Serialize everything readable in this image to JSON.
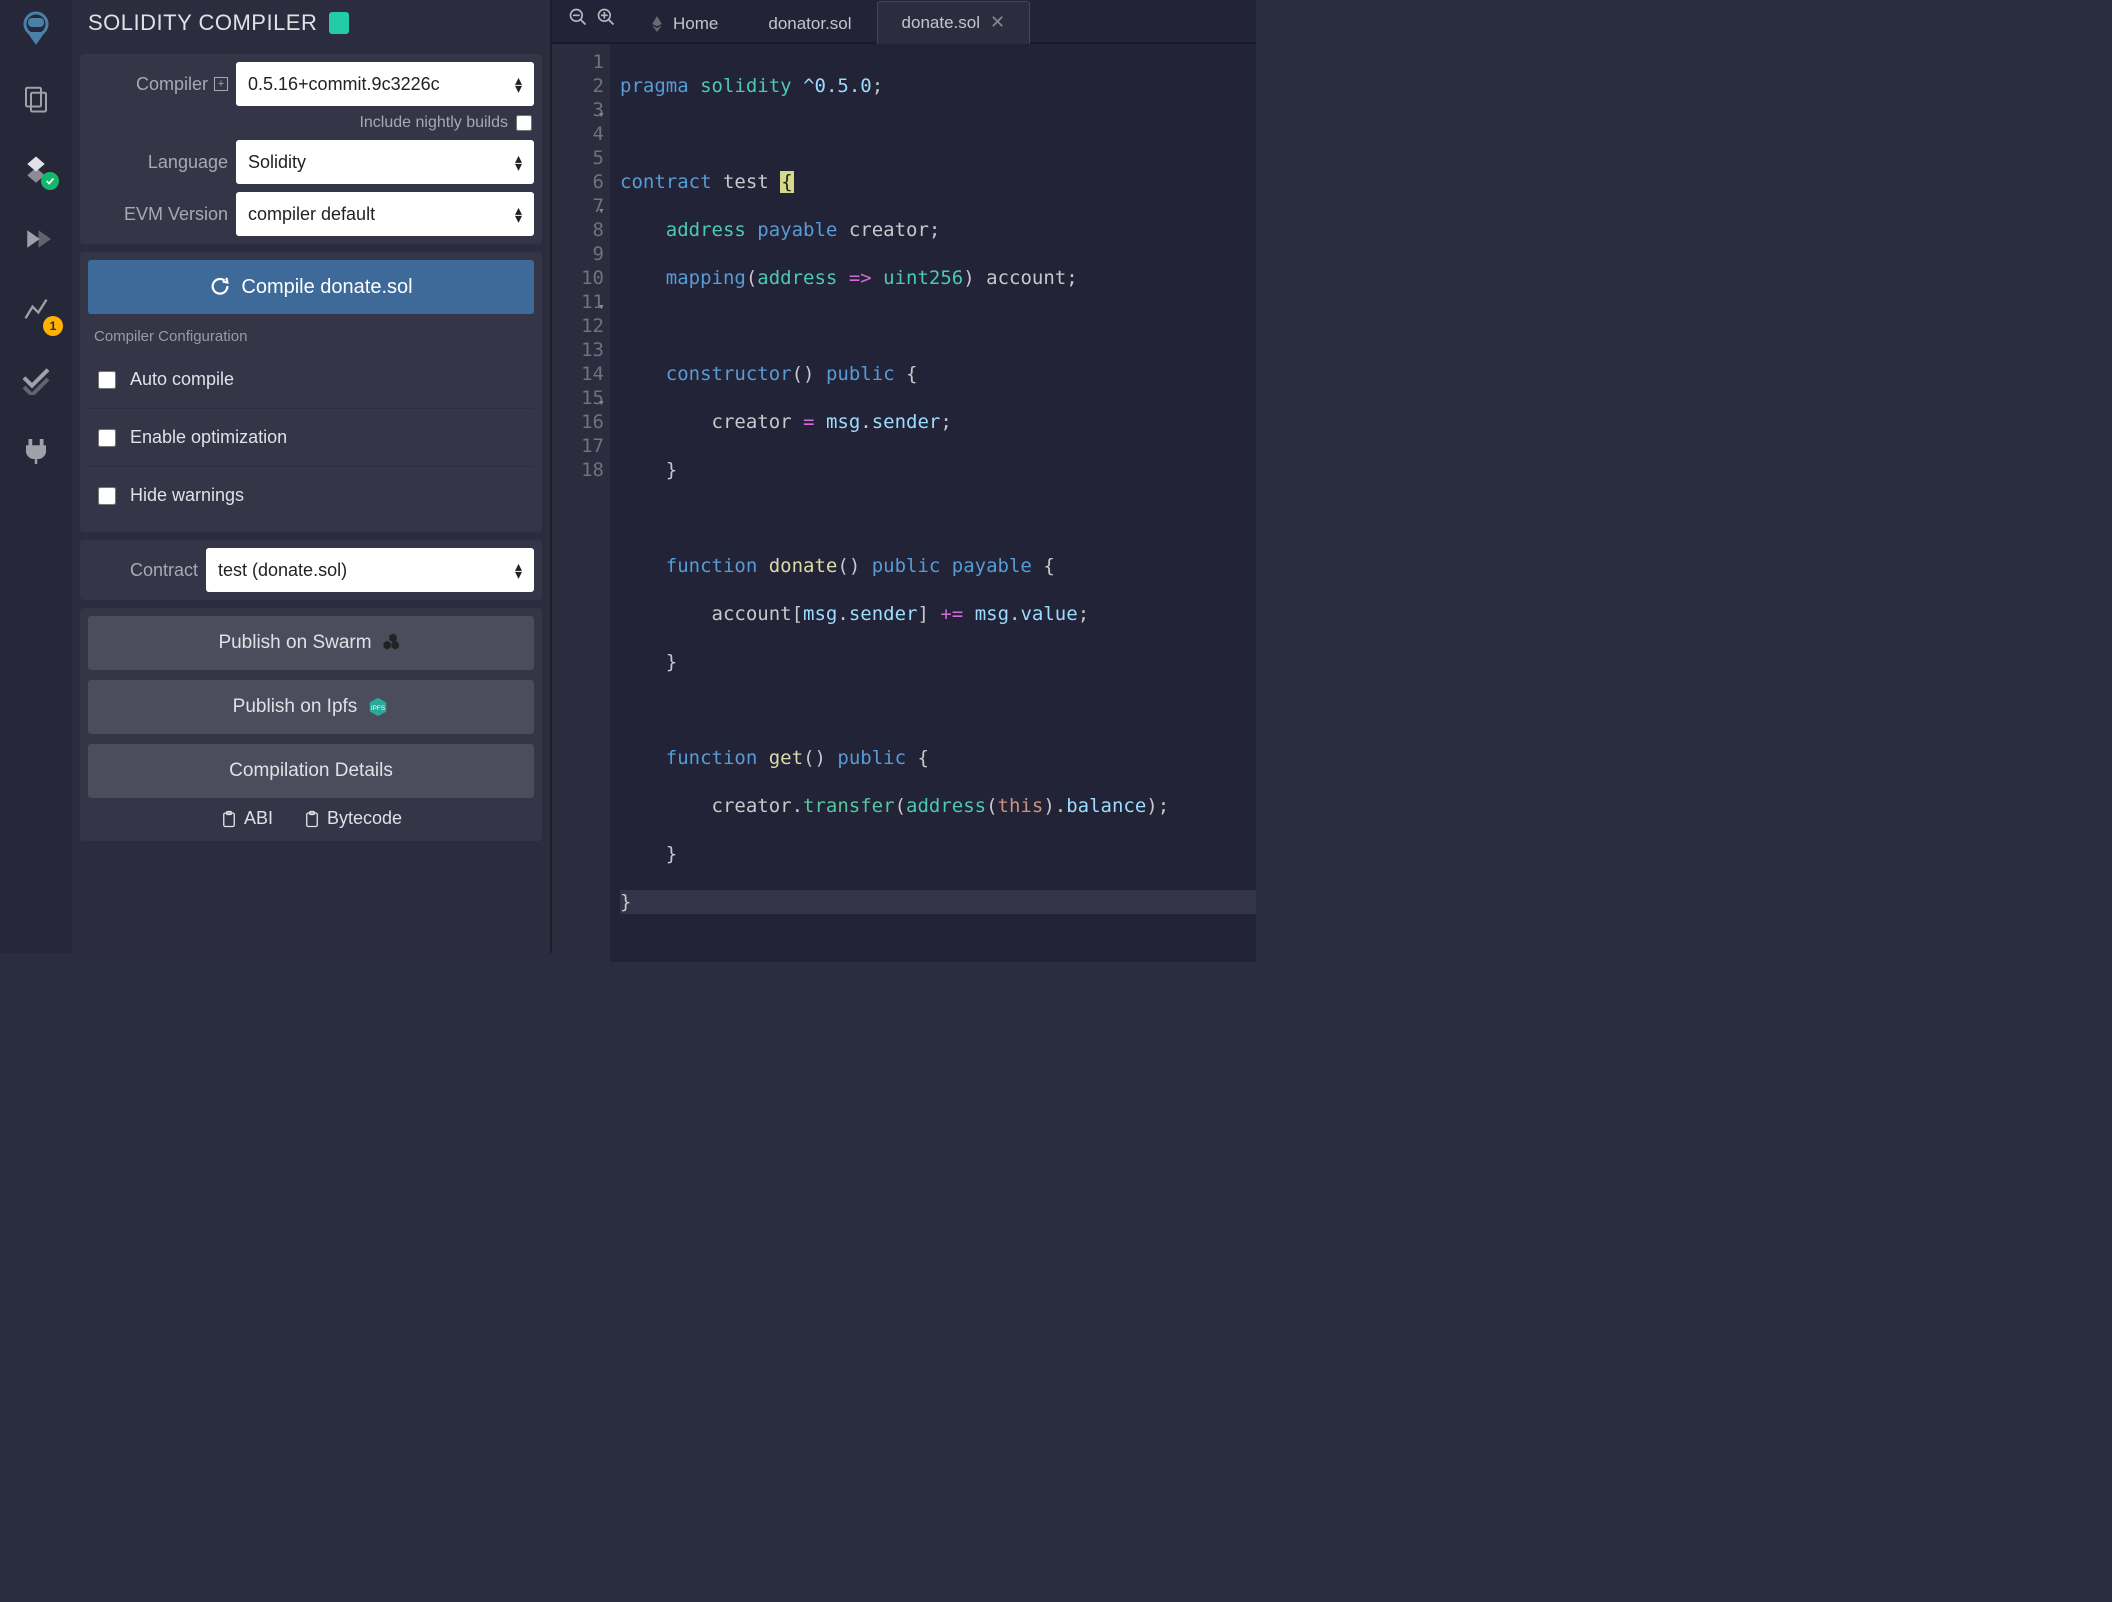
{
  "app": {
    "title": "SOLIDITY COMPILER"
  },
  "iconbar": {
    "items": [
      {
        "name": "logo"
      },
      {
        "name": "file-explorer"
      },
      {
        "name": "compiler",
        "active": true,
        "check": true
      },
      {
        "name": "deploy"
      },
      {
        "name": "analysis",
        "badge": "1"
      },
      {
        "name": "tests"
      },
      {
        "name": "plugins"
      }
    ]
  },
  "form": {
    "compiler_label": "Compiler",
    "compiler_value": "0.5.16+commit.9c3226c",
    "nightly_label": "Include nightly builds",
    "language_label": "Language",
    "language_value": "Solidity",
    "evm_label": "EVM Version",
    "evm_value": "compiler default"
  },
  "compile_button": "Compile donate.sol",
  "config": {
    "heading": "Compiler Configuration",
    "auto": "Auto compile",
    "optimize": "Enable optimization",
    "hide": "Hide warnings"
  },
  "contract": {
    "label": "Contract",
    "value": "test (donate.sol)"
  },
  "buttons": {
    "swarm": "Publish on Swarm",
    "ipfs": "Publish on Ipfs",
    "details": "Compilation Details",
    "abi": "ABI",
    "bytecode": "Bytecode"
  },
  "tabs": [
    {
      "label": "Home",
      "home": true
    },
    {
      "label": "donator.sol"
    },
    {
      "label": "donate.sol",
      "active": true,
      "closable": true
    }
  ],
  "editor": {
    "line_count": 18,
    "fold_lines": [
      3,
      7,
      11,
      15
    ],
    "highlight_line": 18
  },
  "code": {
    "l1a": "pragma",
    "l1b": "solidity",
    "l1c": "^0.5.0",
    "l3a": "contract",
    "l3b": "test",
    "l4a": "address",
    "l4b": "payable",
    "l4c": "creator",
    "l5a": "mapping",
    "l5b": "address",
    "l5c": "=>",
    "l5d": "uint256",
    "l5e": "account",
    "l7a": "constructor",
    "l7b": "public",
    "l8a": "creator",
    "l8b": "=",
    "l8c": "msg",
    "l8d": "sender",
    "l11a": "function",
    "l11b": "donate",
    "l11c": "public",
    "l11d": "payable",
    "l12a": "account",
    "l12b": "msg",
    "l12c": "sender",
    "l12d": "+=",
    "l12e": "msg",
    "l12f": "value",
    "l15a": "function",
    "l15b": "get",
    "l15c": "public",
    "l16a": "creator",
    "l16b": "transfer",
    "l16c": "address",
    "l16d": "this",
    "l16e": "balance"
  }
}
